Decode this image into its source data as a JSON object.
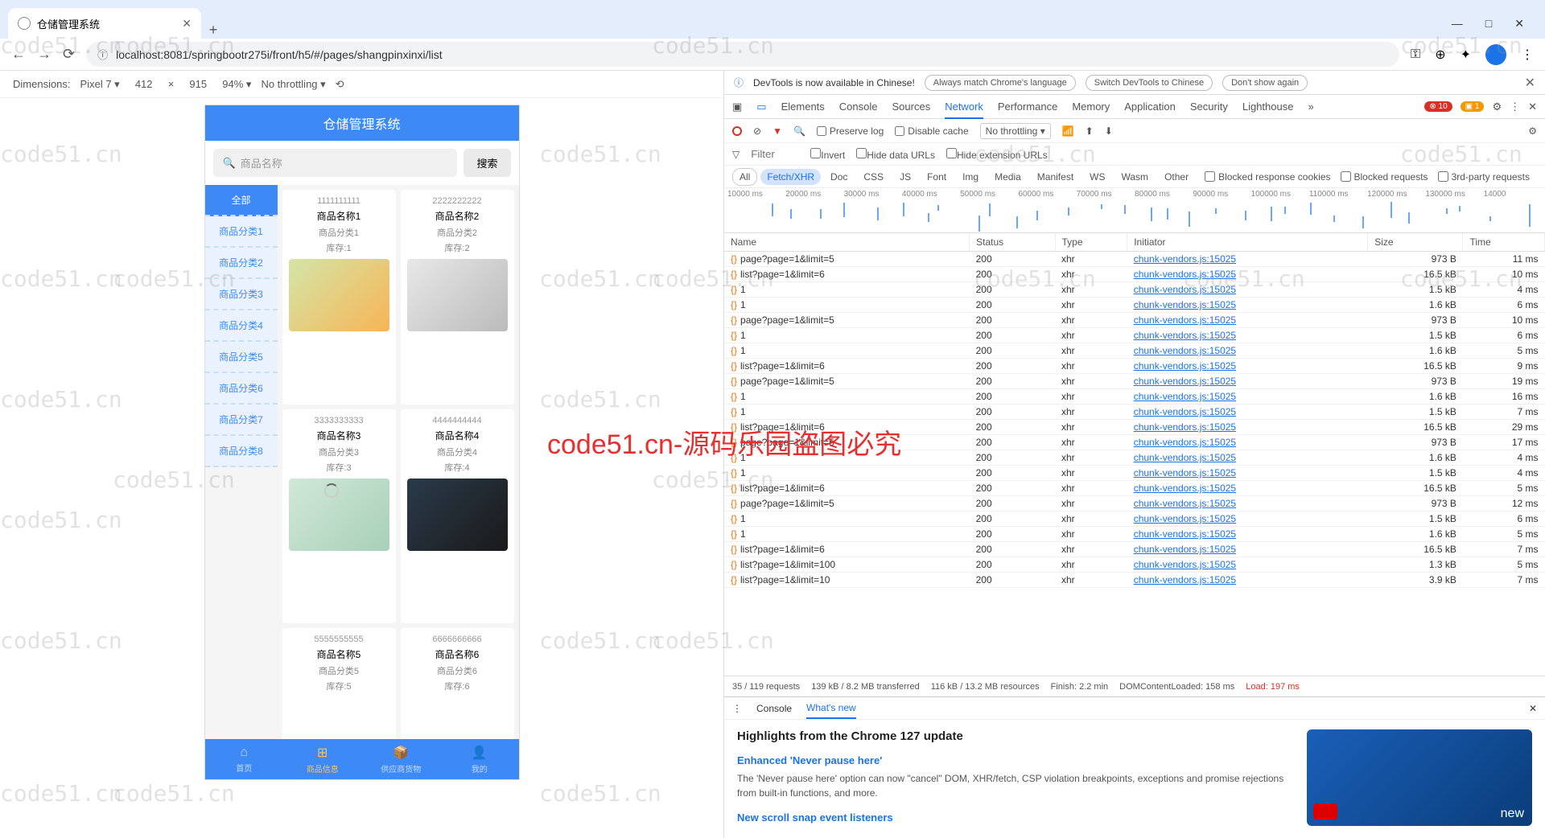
{
  "browser": {
    "tab_title": "仓储管理系统",
    "new_tab": "+",
    "win_min": "—",
    "win_max": "□",
    "win_close": "✕",
    "nav_back": "←",
    "nav_fwd": "→",
    "nav_reload": "⟳",
    "url": "localhost:8081/springbootr275i/front/h5/#/pages/shangpinxinxi/list",
    "tool_key": "⚿",
    "tool_zoom": "⊕",
    "tool_ext": "✦",
    "tool_more": "⋮"
  },
  "emulator": {
    "dims_label": "Dimensions:",
    "device": "Pixel 7 ▾",
    "w": "412",
    "times": "×",
    "h": "915",
    "zoom": "94% ▾",
    "throttling": "No throttling ▾",
    "rotate": "⟲"
  },
  "phone": {
    "title": "仓储管理系统",
    "search_placeholder": "商品名称",
    "search_icon": "🔍",
    "search_btn": "搜索",
    "categories": [
      "全部",
      "商品分类1",
      "商品分类2",
      "商品分类3",
      "商品分类4",
      "商品分类5",
      "商品分类6",
      "商品分类7",
      "商品分类8"
    ],
    "products": [
      {
        "num": "1111111111",
        "name": "商品名称1",
        "cat": "商品分类1",
        "stock": "库存:1",
        "img": "juice"
      },
      {
        "num": "2222222222",
        "name": "商品名称2",
        "cat": "商品分类2",
        "stock": "库存:2",
        "img": "heater"
      },
      {
        "num": "3333333333",
        "name": "商品名称3",
        "cat": "商品分类3",
        "stock": "库存:3",
        "img": "shoe"
      },
      {
        "num": "4444444444",
        "name": "商品名称4",
        "cat": "商品分类4",
        "stock": "库存:4",
        "img": "cap"
      },
      {
        "num": "5555555555",
        "name": "商品名称5",
        "cat": "商品分类5",
        "stock": "库存:5",
        "img": ""
      },
      {
        "num": "6666666666",
        "name": "商品名称6",
        "cat": "商品分类6",
        "stock": "库存:6",
        "img": ""
      }
    ],
    "bottom": [
      {
        "icon": "⌂",
        "label": "首页"
      },
      {
        "icon": "⊞",
        "label": "商品信息"
      },
      {
        "icon": "📦",
        "label": "供应商货物"
      },
      {
        "icon": "👤",
        "label": "我的"
      }
    ]
  },
  "devtools": {
    "banner_msg": "DevTools is now available in Chinese!",
    "banner_opt1": "Always match Chrome's language",
    "banner_opt2": "Switch DevTools to Chinese",
    "banner_opt3": "Don't show again",
    "tabs": [
      "Elements",
      "Console",
      "Sources",
      "Network",
      "Performance",
      "Memory",
      "Application",
      "Security",
      "Lighthouse"
    ],
    "tabs_more": "»",
    "err_count": "10",
    "warn_count": "1",
    "ctrl_preserve": "Preserve log",
    "ctrl_disable": "Disable cache",
    "ctrl_throttle": "No throttling ▾",
    "filter_label": "Filter",
    "filter_placeholder": "Filter",
    "invert": "Invert",
    "hide_data": "Hide data URLs",
    "hide_ext": "Hide extension URLs",
    "types": [
      "All",
      "Fetch/XHR",
      "Doc",
      "CSS",
      "JS",
      "Font",
      "Img",
      "Media",
      "Manifest",
      "WS",
      "Wasm",
      "Other"
    ],
    "blocked_cookies": "Blocked response cookies",
    "blocked_req": "Blocked requests",
    "third_party": "3rd-party requests",
    "timeline_ticks": [
      "10000 ms",
      "20000 ms",
      "30000 ms",
      "40000 ms",
      "50000 ms",
      "60000 ms",
      "70000 ms",
      "80000 ms",
      "90000 ms",
      "100000 ms",
      "110000 ms",
      "120000 ms",
      "130000 ms",
      "14000"
    ],
    "cols": [
      "Name",
      "Status",
      "Type",
      "Initiator",
      "Size",
      "Time"
    ],
    "rows": [
      {
        "name": "page?page=1&limit=5",
        "status": "200",
        "type": "xhr",
        "init": "chunk-vendors.js:15025",
        "size": "973 B",
        "time": "11 ms"
      },
      {
        "name": "list?page=1&limit=6",
        "status": "200",
        "type": "xhr",
        "init": "chunk-vendors.js:15025",
        "size": "16.5 kB",
        "time": "10 ms"
      },
      {
        "name": "1",
        "status": "200",
        "type": "xhr",
        "init": "chunk-vendors.js:15025",
        "size": "1.5 kB",
        "time": "4 ms"
      },
      {
        "name": "1",
        "status": "200",
        "type": "xhr",
        "init": "chunk-vendors.js:15025",
        "size": "1.6 kB",
        "time": "6 ms"
      },
      {
        "name": "page?page=1&limit=5",
        "status": "200",
        "type": "xhr",
        "init": "chunk-vendors.js:15025",
        "size": "973 B",
        "time": "10 ms"
      },
      {
        "name": "1",
        "status": "200",
        "type": "xhr",
        "init": "chunk-vendors.js:15025",
        "size": "1.5 kB",
        "time": "6 ms"
      },
      {
        "name": "1",
        "status": "200",
        "type": "xhr",
        "init": "chunk-vendors.js:15025",
        "size": "1.6 kB",
        "time": "5 ms"
      },
      {
        "name": "list?page=1&limit=6",
        "status": "200",
        "type": "xhr",
        "init": "chunk-vendors.js:15025",
        "size": "16.5 kB",
        "time": "9 ms"
      },
      {
        "name": "page?page=1&limit=5",
        "status": "200",
        "type": "xhr",
        "init": "chunk-vendors.js:15025",
        "size": "973 B",
        "time": "19 ms"
      },
      {
        "name": "1",
        "status": "200",
        "type": "xhr",
        "init": "chunk-vendors.js:15025",
        "size": "1.6 kB",
        "time": "16 ms"
      },
      {
        "name": "1",
        "status": "200",
        "type": "xhr",
        "init": "chunk-vendors.js:15025",
        "size": "1.5 kB",
        "time": "7 ms"
      },
      {
        "name": "list?page=1&limit=6",
        "status": "200",
        "type": "xhr",
        "init": "chunk-vendors.js:15025",
        "size": "16.5 kB",
        "time": "29 ms"
      },
      {
        "name": "page?page=1&limit=5",
        "status": "200",
        "type": "xhr",
        "init": "chunk-vendors.js:15025",
        "size": "973 B",
        "time": "17 ms"
      },
      {
        "name": "1",
        "status": "200",
        "type": "xhr",
        "init": "chunk-vendors.js:15025",
        "size": "1.6 kB",
        "time": "4 ms"
      },
      {
        "name": "1",
        "status": "200",
        "type": "xhr",
        "init": "chunk-vendors.js:15025",
        "size": "1.5 kB",
        "time": "4 ms"
      },
      {
        "name": "list?page=1&limit=6",
        "status": "200",
        "type": "xhr",
        "init": "chunk-vendors.js:15025",
        "size": "16.5 kB",
        "time": "5 ms"
      },
      {
        "name": "page?page=1&limit=5",
        "status": "200",
        "type": "xhr",
        "init": "chunk-vendors.js:15025",
        "size": "973 B",
        "time": "12 ms"
      },
      {
        "name": "1",
        "status": "200",
        "type": "xhr",
        "init": "chunk-vendors.js:15025",
        "size": "1.5 kB",
        "time": "6 ms"
      },
      {
        "name": "1",
        "status": "200",
        "type": "xhr",
        "init": "chunk-vendors.js:15025",
        "size": "1.6 kB",
        "time": "5 ms"
      },
      {
        "name": "list?page=1&limit=6",
        "status": "200",
        "type": "xhr",
        "init": "chunk-vendors.js:15025",
        "size": "16.5 kB",
        "time": "7 ms"
      },
      {
        "name": "list?page=1&limit=100",
        "status": "200",
        "type": "xhr",
        "init": "chunk-vendors.js:15025",
        "size": "1.3 kB",
        "time": "5 ms"
      },
      {
        "name": "list?page=1&limit=10",
        "status": "200",
        "type": "xhr",
        "init": "chunk-vendors.js:15025",
        "size": "3.9 kB",
        "time": "7 ms"
      }
    ],
    "status_req": "35 / 119 requests",
    "status_xfer": "139 kB / 8.2 MB transferred",
    "status_res": "116 kB / 13.2 MB resources",
    "status_finish": "Finish: 2.2 min",
    "status_dom": "DOMContentLoaded: 158 ms",
    "status_load": "Load: 197 ms",
    "lower_tabs": [
      "Console",
      "What's new"
    ],
    "highlights": "Highlights from the Chrome 127 update",
    "sect1_title": "Enhanced 'Never pause here'",
    "sect1_body": "The 'Never pause here' option can now \"cancel\" DOM, XHR/fetch, CSP violation breakpoints, exceptions and promise rejections from built-in functions, and more.",
    "sect2_title": "New scroll snap event listeners",
    "video_new": "new"
  },
  "watermark": {
    "grey": "code51.cn",
    "red": "code51.cn-源码乐园盗图必究"
  }
}
